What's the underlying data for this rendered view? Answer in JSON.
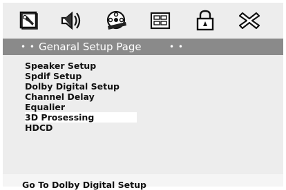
{
  "toolbar": {
    "icons": [
      {
        "name": "general-setup-icon"
      },
      {
        "name": "speaker-setup-icon"
      },
      {
        "name": "video-setup-icon"
      },
      {
        "name": "preference-icon"
      },
      {
        "name": "password-lock-icon"
      },
      {
        "name": "exit-icon"
      }
    ]
  },
  "title_bar": {
    "dots_left": "• •",
    "title": "Genaral Setup Page",
    "dots_right": "• •"
  },
  "menu": {
    "items": [
      {
        "label": "Speaker Setup"
      },
      {
        "label": "Spdif Setup"
      },
      {
        "label": "Dolby Digital Setup"
      },
      {
        "label": "Channel Delay"
      },
      {
        "label": "Equalier"
      },
      {
        "label": "3D Prosessing",
        "highlighted": true
      },
      {
        "label": "HDCD"
      }
    ]
  },
  "status": {
    "text": "Go To Dolby Digital Setup"
  },
  "colors": {
    "panel_bg": "#ededed",
    "title_bar_bg": "#8a8a8a",
    "highlight_bg": "#ffffff",
    "text": "#111111"
  }
}
